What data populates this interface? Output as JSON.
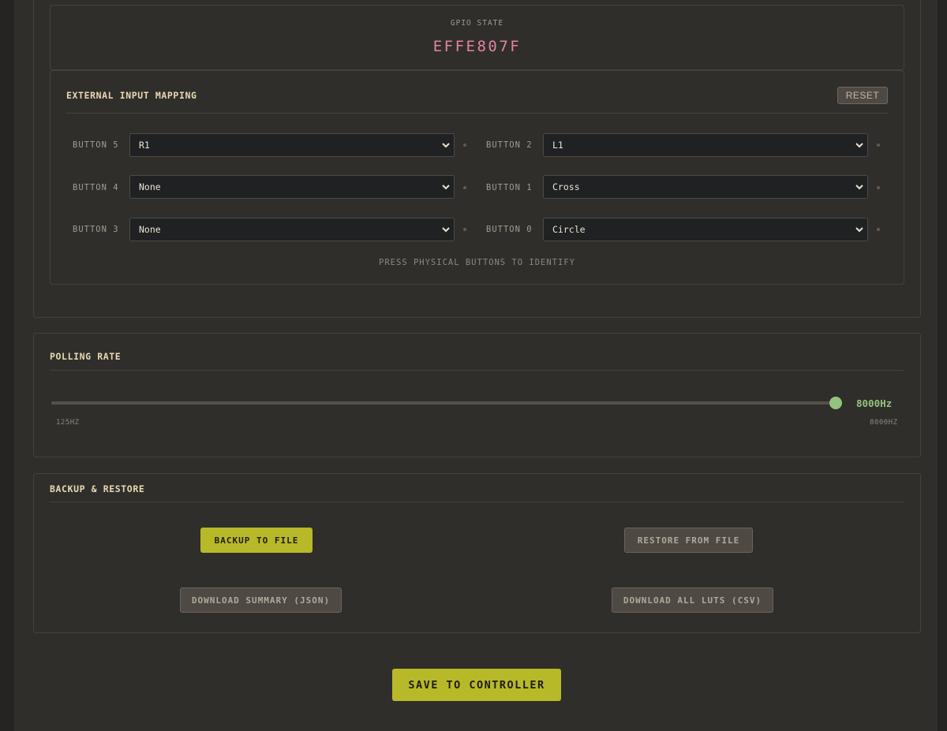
{
  "gpio": {
    "label": "GPIO STATE",
    "value": "EFFE807F"
  },
  "mapping": {
    "title": "EXTERNAL INPUT MAPPING",
    "reset_label": "RESET",
    "rows": [
      {
        "left_label": "BUTTON 5",
        "left_value": "R1",
        "right_label": "BUTTON 2",
        "right_value": "L1"
      },
      {
        "left_label": "BUTTON 4",
        "left_value": "None",
        "right_label": "BUTTON 1",
        "right_value": "Cross"
      },
      {
        "left_label": "BUTTON 3",
        "left_value": "None",
        "right_label": "BUTTON 0",
        "right_value": "Circle"
      }
    ],
    "hint": "PRESS PHYSICAL BUTTONS TO IDENTIFY"
  },
  "polling": {
    "title": "POLLING RATE",
    "value_label": "8000Hz",
    "slider_fraction": 1.0,
    "min_label": "125HZ",
    "max_label": "8000HZ",
    "accent_color": "#93c47d"
  },
  "backup": {
    "title": "BACKUP & RESTORE",
    "backup_label": "BACKUP TO FILE",
    "restore_label": "RESTORE FROM FILE",
    "summary_label": "DOWNLOAD SUMMARY (JSON)",
    "luts_label": "DOWNLOAD ALL LUTS (CSV)"
  },
  "save_label": "SAVE TO CONTROLLER"
}
